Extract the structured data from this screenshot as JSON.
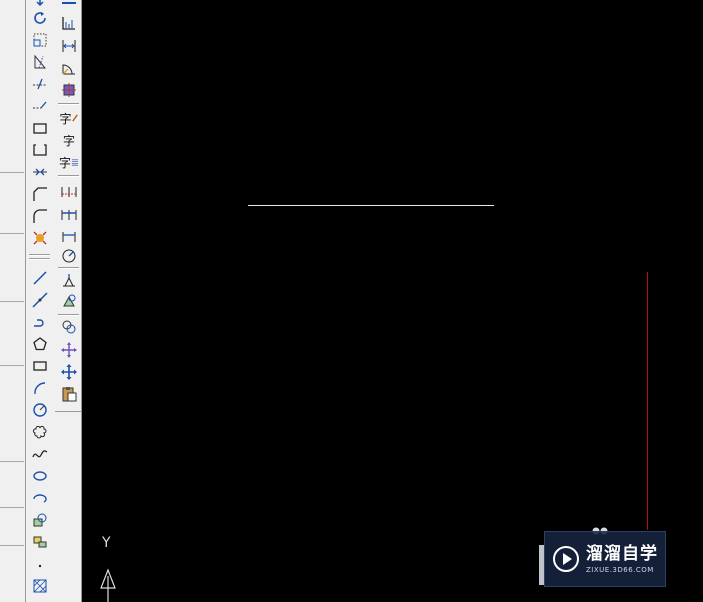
{
  "left_panel": {
    "visible": true
  },
  "toolbar_left": {
    "tools": [
      {
        "name": "move-icon"
      },
      {
        "name": "rotate-icon"
      },
      {
        "name": "scale-icon"
      },
      {
        "name": "stretch-icon"
      },
      {
        "name": "trim-icon"
      },
      {
        "name": "extend-icon"
      },
      {
        "name": "break-at-point-icon"
      },
      {
        "name": "break-icon"
      },
      {
        "name": "join-icon"
      },
      {
        "name": "chamfer-icon"
      },
      {
        "name": "fillet-icon"
      },
      {
        "name": "explode-icon"
      },
      {
        "name": "line-icon"
      },
      {
        "name": "construction-line-icon"
      },
      {
        "name": "polyline-icon"
      },
      {
        "name": "polygon-icon"
      },
      {
        "name": "rectangle-icon"
      },
      {
        "name": "arc-icon"
      },
      {
        "name": "circle-icon"
      },
      {
        "name": "revision-cloud-icon"
      },
      {
        "name": "spline-icon"
      },
      {
        "name": "ellipse-icon"
      },
      {
        "name": "ellipse-arc-icon"
      },
      {
        "name": "insert-block-icon"
      },
      {
        "name": "make-block-icon"
      },
      {
        "name": "point-icon"
      },
      {
        "name": "hatch-icon"
      }
    ]
  },
  "toolbar_right": {
    "tools": [
      {
        "name": "linear-dimension-icon"
      },
      {
        "name": "ordinate-dimension-icon"
      },
      {
        "name": "aligned-dimension-icon"
      },
      {
        "name": "arc-length-icon"
      },
      {
        "name": "center-mark-icon"
      },
      {
        "name": "text-edit-icon",
        "glyph": "字"
      },
      {
        "name": "text-style-icon",
        "glyph": "字"
      },
      {
        "name": "multiline-text-icon",
        "glyph": "字"
      },
      {
        "name": "baseline-dimension-icon"
      },
      {
        "name": "continue-dimension-icon"
      },
      {
        "name": "quick-dimension-icon"
      },
      {
        "name": "radius-dimension-icon"
      },
      {
        "name": "dimension-edit-icon"
      },
      {
        "name": "dimension-update-icon"
      },
      {
        "name": "copy-icon"
      },
      {
        "name": "move-arrows-icon"
      },
      {
        "name": "pan-icon"
      },
      {
        "name": "paste-icon"
      }
    ]
  },
  "drawing": {
    "ucs_axis_label": "Y"
  },
  "watermark": {
    "title": "溜溜自学",
    "url": "ZIXUE.3D66.COM",
    "background": "#162440"
  },
  "colors": {
    "canvas": "#000000",
    "line": "#e8e8e8",
    "red_line": "#b01010",
    "toolbar": "#f0f0f0"
  }
}
